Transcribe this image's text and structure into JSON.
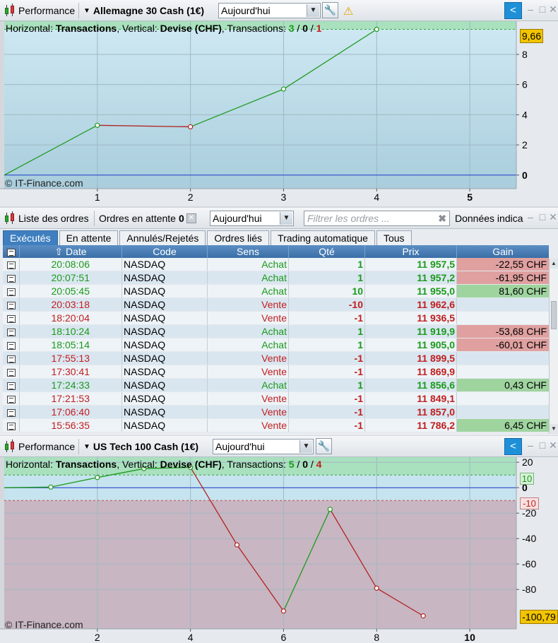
{
  "top_panel": {
    "toolbar": {
      "title": "Performance",
      "instrument": "Allemagne 30 Cash (1€)",
      "period": "Aujourd'hui"
    },
    "header": {
      "prefix": "Horizontal: ",
      "h_value": "Transactions",
      "mid": ", Vertical: ",
      "v_value": "Devise (CHF)",
      "tx_label": ", Transactions: ",
      "tx_win": "3",
      "tx_sep1": " / ",
      "tx_neutral": "0",
      "tx_sep2": " / ",
      "tx_loss": "1"
    },
    "watermark": "© IT-Finance.com",
    "last_value": "9,66"
  },
  "orders_panel": {
    "toolbar": {
      "title": "Liste des ordres",
      "pending_label": "Ordres en attente",
      "pending_count": "0",
      "period": "Aujourd'hui",
      "filter_placeholder": "Filtrer les ordres ...",
      "extra_label": "Données indica"
    },
    "tabs": [
      "Exécutés",
      "En attente",
      "Annulés/Rejetés",
      "Ordres liés",
      "Trading automatique",
      "Tous"
    ],
    "columns": [
      "Date",
      "Code",
      "Sens",
      "Qté",
      "Prix",
      "Gain"
    ],
    "rows": [
      {
        "date": "20:08:06",
        "code": "NASDAQ",
        "sens": "Achat",
        "qte": "1",
        "prix": "11 957,5",
        "gain": "-22,55 CHF"
      },
      {
        "date": "20:07:51",
        "code": "NASDAQ",
        "sens": "Achat",
        "qte": "1",
        "prix": "11 957,2",
        "gain": "-61,95 CHF"
      },
      {
        "date": "20:05:45",
        "code": "NASDAQ",
        "sens": "Achat",
        "qte": "10",
        "prix": "11 955,0",
        "gain": "81,60 CHF"
      },
      {
        "date": "20:03:18",
        "code": "NASDAQ",
        "sens": "Vente",
        "qte": "-10",
        "prix": "11 962,6",
        "gain": ""
      },
      {
        "date": "18:20:04",
        "code": "NASDAQ",
        "sens": "Vente",
        "qte": "-1",
        "prix": "11 936,5",
        "gain": ""
      },
      {
        "date": "18:10:24",
        "code": "NASDAQ",
        "sens": "Achat",
        "qte": "1",
        "prix": "11 919,9",
        "gain": "-53,68 CHF"
      },
      {
        "date": "18:05:14",
        "code": "NASDAQ",
        "sens": "Achat",
        "qte": "1",
        "prix": "11 905,0",
        "gain": "-60,01 CHF"
      },
      {
        "date": "17:55:13",
        "code": "NASDAQ",
        "sens": "Vente",
        "qte": "-1",
        "prix": "11 899,5",
        "gain": ""
      },
      {
        "date": "17:30:41",
        "code": "NASDAQ",
        "sens": "Vente",
        "qte": "-1",
        "prix": "11 869,9",
        "gain": ""
      },
      {
        "date": "17:24:33",
        "code": "NASDAQ",
        "sens": "Achat",
        "qte": "1",
        "prix": "11 856,6",
        "gain": "0,43 CHF"
      },
      {
        "date": "17:21:53",
        "code": "NASDAQ",
        "sens": "Vente",
        "qte": "-1",
        "prix": "11 849,1",
        "gain": ""
      },
      {
        "date": "17:06:40",
        "code": "NASDAQ",
        "sens": "Vente",
        "qte": "-1",
        "prix": "11 857,0",
        "gain": ""
      },
      {
        "date": "15:56:35",
        "code": "NASDAQ",
        "sens": "Vente",
        "qte": "-1",
        "prix": "11 786,2",
        "gain": "6,45 CHF"
      }
    ]
  },
  "bottom_panel": {
    "toolbar": {
      "title": "Performance",
      "instrument": "US Tech 100 Cash (1€)",
      "period": "Aujourd'hui"
    },
    "header": {
      "prefix": "Horizontal: ",
      "h_value": "Transactions",
      "mid": ", Vertical: ",
      "v_value": "Devise (CHF)",
      "tx_label": ", Transactions: ",
      "tx_win": "5",
      "tx_sep1": " / ",
      "tx_neutral": "0",
      "tx_sep2": " / ",
      "tx_loss": "4"
    },
    "watermark": "© IT-Finance.com",
    "upper_band_label": "10",
    "lower_band_label": "-10",
    "last_value": "-100,79"
  },
  "colors": {
    "gain": "#1a9a1a",
    "loss": "#c01e1e",
    "accent": "#3f7fbf"
  },
  "chart_data": [
    {
      "type": "line",
      "x": [
        0,
        1,
        2,
        3,
        4
      ],
      "y": [
        0,
        3.3,
        3.2,
        5.7,
        9.66
      ],
      "segments_colors": [
        "green",
        "red",
        "green",
        "green"
      ],
      "xlim": [
        0,
        5.5
      ],
      "ylim": [
        -0.9,
        10.2
      ],
      "x_ticks": [
        "1",
        "2",
        "3",
        "4",
        "5"
      ],
      "y_ticks": [
        "0",
        "2",
        "4",
        "6",
        "8"
      ]
    },
    {
      "type": "line",
      "x": [
        0,
        1,
        2,
        3,
        4,
        5,
        6,
        7,
        8,
        9
      ],
      "y": [
        0,
        0.5,
        8,
        15,
        16,
        -45,
        -97,
        -17,
        -79,
        -100.79
      ],
      "segments_colors": [
        "green",
        "green",
        "green",
        "green",
        "red",
        "red",
        "green",
        "red",
        "red"
      ],
      "xlim": [
        0,
        11
      ],
      "ylim": [
        -111,
        24
      ],
      "x_ticks": [
        "2",
        "4",
        "6",
        "8",
        "10"
      ],
      "y_ticks": [
        "20",
        "0",
        "-20",
        "-40",
        "-60",
        "-80"
      ]
    }
  ]
}
